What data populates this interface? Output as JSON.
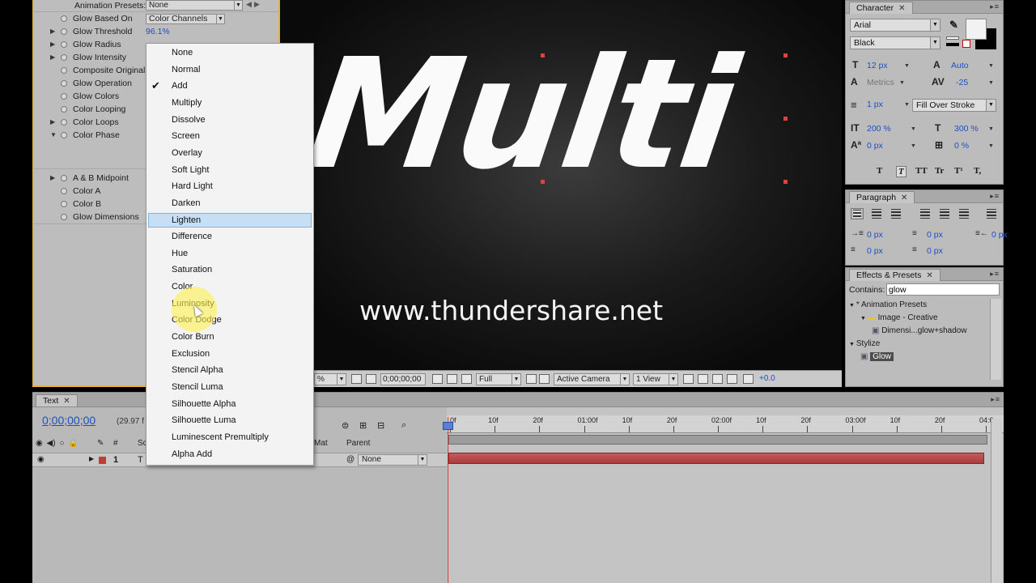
{
  "effect_controls": {
    "animation_presets_label": "Animation Presets:",
    "animation_presets_value": "None",
    "rows": [
      {
        "label": "Glow Based On",
        "value": "Color Channels",
        "kind": "select",
        "twirl": false
      },
      {
        "label": "Glow Threshold",
        "value": "96.1%",
        "kind": "num",
        "twirl": true
      },
      {
        "label": "Glow Radius",
        "value": "",
        "kind": "none",
        "twirl": true
      },
      {
        "label": "Glow Intensity",
        "value": "",
        "kind": "none",
        "twirl": true
      },
      {
        "label": "Composite Original",
        "value": "",
        "kind": "tick",
        "twirl": false
      },
      {
        "label": "Glow Operation",
        "value": "",
        "kind": "tick",
        "twirl": false
      },
      {
        "label": "Glow Colors",
        "value": "",
        "kind": "tick",
        "twirl": false
      },
      {
        "label": "Color Looping",
        "value": "",
        "kind": "tick",
        "twirl": false
      },
      {
        "label": "Color Loops",
        "value": "",
        "kind": "tick",
        "twirl": true
      },
      {
        "label": "Color Phase",
        "value": "",
        "kind": "none",
        "twirl": true,
        "open": true
      }
    ],
    "rows2": [
      {
        "label": "A & B Midpoint",
        "twirl": true
      },
      {
        "label": "Color A",
        "twirl": false
      },
      {
        "label": "Color B",
        "twirl": false
      },
      {
        "label": "Glow Dimensions",
        "twirl": false
      }
    ]
  },
  "blend_menu": {
    "items": [
      "None",
      "Normal",
      "Add",
      "Multiply",
      "Dissolve",
      "Screen",
      "Overlay",
      "Soft Light",
      "Hard Light",
      "Darken",
      "Lighten",
      "Difference",
      "Hue",
      "Saturation",
      "Color",
      "Luminosity",
      "Color Dodge",
      "Color Burn",
      "Exclusion",
      "Stencil Alpha",
      "Stencil Luma",
      "Silhouette Alpha",
      "Silhouette Luma",
      "Luminescent Premultiply",
      "Alpha Add"
    ],
    "checked": "Add",
    "highlighted": "Lighten"
  },
  "composition": {
    "title_text": "Multi",
    "url_text": "www.thundershare.net"
  },
  "viewer_bar": {
    "zoom": "%",
    "timecode": "0;00;00;00",
    "resolution": "Full",
    "camera": "Active Camera",
    "views": "1 View",
    "exposure": "+0.0"
  },
  "character": {
    "tab": "Character",
    "font": "Arial",
    "style": "Black",
    "font_size": "12 px",
    "leading": "Auto",
    "kerning": "Metrics",
    "tracking": "-25",
    "stroke_width": "1 px",
    "stroke_mode": "Fill Over Stroke",
    "vert_scale": "200 %",
    "horiz_scale": "300 %",
    "baseline": "0 px",
    "tsume": "0 %",
    "format_buttons": [
      "T",
      "T",
      "TT",
      "Tr",
      "T¹",
      "T,"
    ],
    "fill_color": "#f2f2f2",
    "stroke_color": "#000000"
  },
  "paragraph": {
    "tab": "Paragraph",
    "indent_left": "0 px",
    "indent_right": "0 px",
    "indent_first": "0 px",
    "space_before": "0 px",
    "space_after": "0 px"
  },
  "effects_presets": {
    "tab": "Effects & Presets",
    "contains_label": "Contains:",
    "search_value": "glow",
    "tree": [
      {
        "label": "* Animation Presets",
        "level": 0
      },
      {
        "label": "Image - Creative",
        "level": 1
      },
      {
        "label": "Dimensi...glow+shadow",
        "level": 2
      },
      {
        "label": "Stylize",
        "level": 0
      },
      {
        "label": "Glow",
        "level": 1,
        "selected": true
      }
    ]
  },
  "timeline": {
    "tab": "Text",
    "timecode": "0;00;00;00",
    "fps": "(29.97 f",
    "col_source": "Sc",
    "col_mode": "Mat",
    "col_parent": "Parent",
    "col_num": "#",
    "layer_num": "1",
    "layer_type": "T",
    "parent_value": "None",
    "ruler": [
      "0f",
      "10f",
      "20f",
      "01:00f",
      "10f",
      "20f",
      "02:00f",
      "10f",
      "20f",
      "03:00f",
      "10f",
      "20f",
      "04:0"
    ]
  }
}
